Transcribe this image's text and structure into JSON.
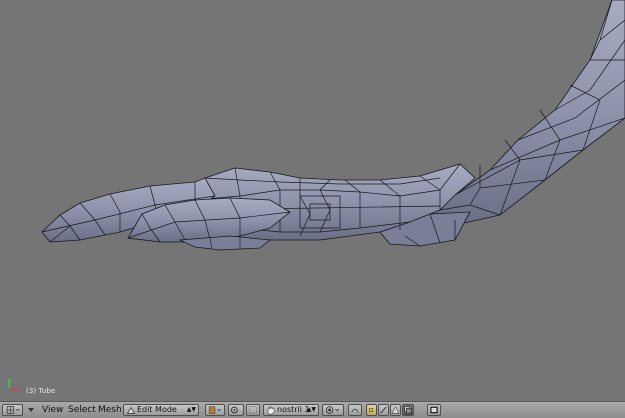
{
  "viewport": {
    "object_label": "(3) Tube",
    "background": "#757575",
    "mesh_color": "#8e93ab",
    "wire_color": "#17181f"
  },
  "header": {
    "menu_view": "View",
    "menu_select": "Select",
    "menu_mesh": "Mesh",
    "mode": {
      "label": "Edit Mode",
      "icon": "edit-mode-icon"
    },
    "orientation": {
      "label": "nostril 1",
      "icon": "hand-icon"
    },
    "icons": [
      "viewport-type-icon",
      "collapse-arrow-icon",
      "shading-icon",
      "pivot-icon",
      "vertex-select-icon",
      "edge-select-icon",
      "face-select-icon",
      "occlude-icon",
      "proportional-icon",
      "render-icon"
    ]
  }
}
